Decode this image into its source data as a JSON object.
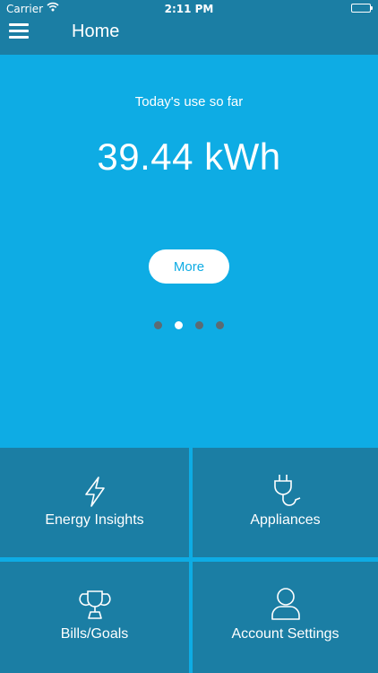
{
  "status_bar": {
    "carrier": "Carrier",
    "time": "2:11 PM"
  },
  "header": {
    "title": "Home",
    "menu_icon": "hamburger-menu-icon"
  },
  "hero": {
    "label": "Today's use so far",
    "value": "39.44 kWh",
    "more_button": "More",
    "page_dots": {
      "count": 4,
      "active_index": 1
    }
  },
  "tiles": [
    {
      "label": "Energy Insights",
      "icon": "lightning-bolt-icon"
    },
    {
      "label": "Appliances",
      "icon": "plug-icon"
    },
    {
      "label": "Bills/Goals",
      "icon": "trophy-icon"
    },
    {
      "label": "Account Settings",
      "icon": "user-icon"
    }
  ],
  "colors": {
    "header_bg": "#1b7ea4",
    "hero_bg": "#0eace4",
    "tile_bg": "#1b7ea4",
    "dot_inactive": "#5c6b73",
    "dot_active": "#ffffff"
  }
}
